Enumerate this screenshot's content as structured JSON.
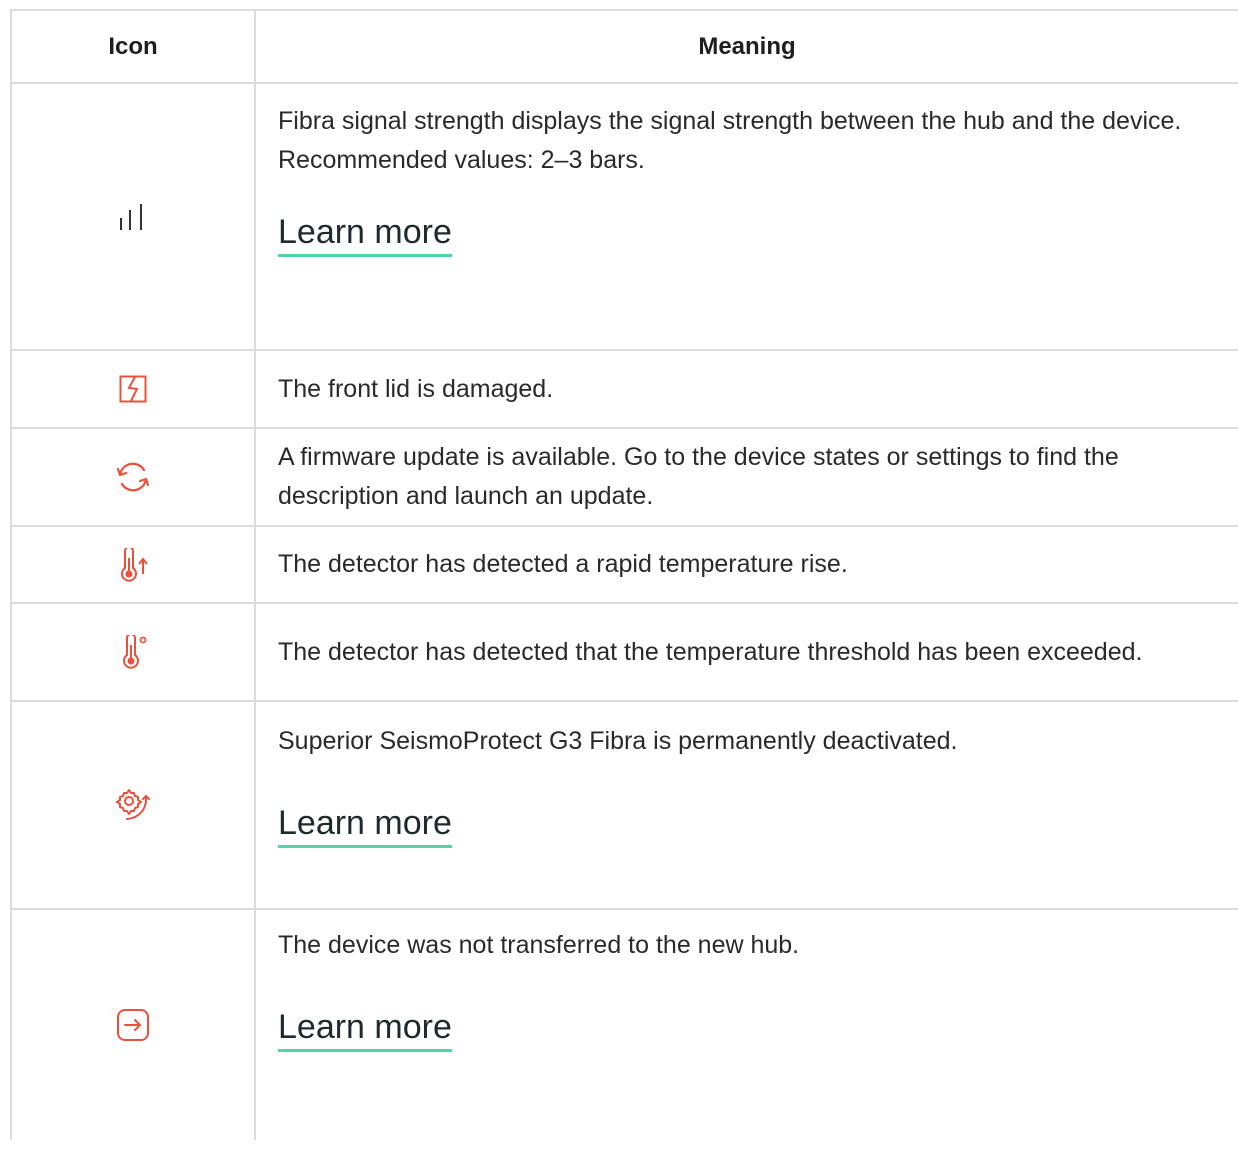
{
  "table": {
    "headers": {
      "icon": "Icon",
      "meaning": "Meaning"
    },
    "rows": [
      {
        "icon": "signal-strength-icon",
        "text": "Fibra signal strength displays the signal strength between the hub and the device. Recommended values: 2–3 bars.",
        "link": "Learn more"
      },
      {
        "icon": "front-lid-damaged-icon",
        "text": "The front lid is damaged."
      },
      {
        "icon": "firmware-update-icon",
        "text": "A firmware update is available. Go to the device states or settings to find the description and launch an update."
      },
      {
        "icon": "temperature-rise-icon",
        "text": "The detector has detected a rapid temperature rise."
      },
      {
        "icon": "temperature-threshold-icon",
        "text": "The detector has detected that the temperature threshold has been exceeded."
      },
      {
        "icon": "device-deactivated-icon",
        "text": "Superior SeismoProtect G3 Fibra is permanently deactivated.",
        "link": "Learn more"
      },
      {
        "icon": "device-not-transferred-icon",
        "text": "The device was not transferred to the new hub.",
        "link": "Learn more"
      }
    ]
  },
  "colors": {
    "icon_accent": "#e8523c",
    "link_underline": "#4fd6a5",
    "border": "#dcdcdc",
    "neutral_icon": "#333333"
  }
}
